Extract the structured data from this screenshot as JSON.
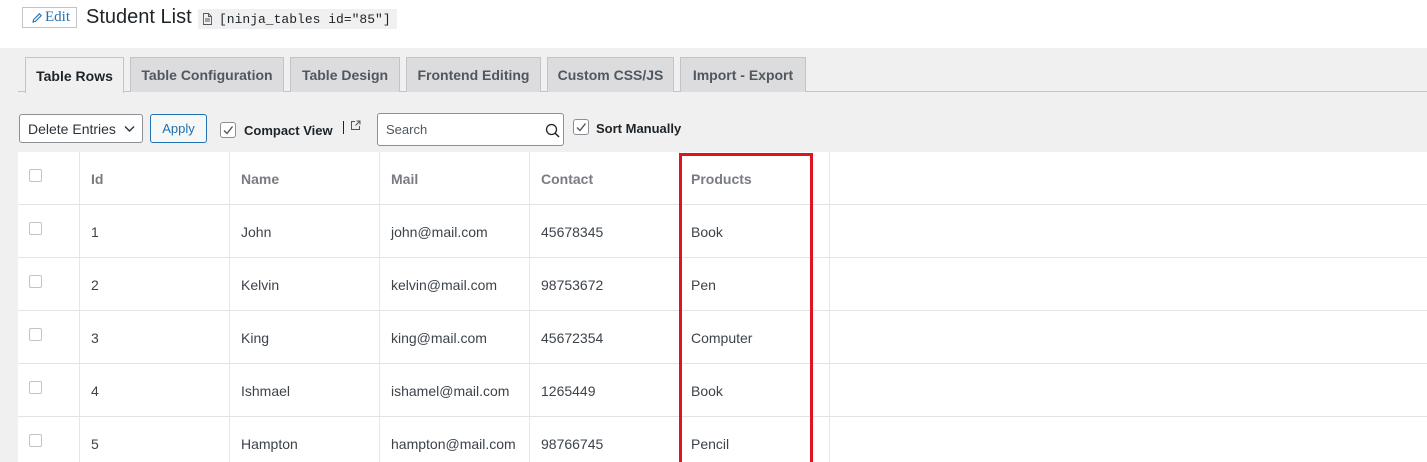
{
  "header": {
    "edit_label": "Edit",
    "title": "Student List",
    "shortcode": "[ninja_tables id=\"85\"]"
  },
  "tabs": [
    {
      "label": "Table Rows",
      "active": true
    },
    {
      "label": "Table Configuration",
      "active": false
    },
    {
      "label": "Table Design",
      "active": false
    },
    {
      "label": "Frontend Editing",
      "active": false
    },
    {
      "label": "Custom CSS/JS",
      "active": false
    },
    {
      "label": "Import - Export",
      "active": false
    }
  ],
  "toolbar": {
    "bulk_action_selected": "Delete Entries",
    "apply_label": "Apply",
    "compact_view_label": "Compact View",
    "compact_view_checked": true,
    "search_placeholder": "Search",
    "sort_manually_label": "Sort Manually",
    "sort_manually_checked": true
  },
  "table": {
    "columns": [
      "Id",
      "Name",
      "Mail",
      "Contact",
      "Products"
    ],
    "rows": [
      {
        "id": "1",
        "name": "John",
        "mail": "john@mail.com",
        "contact": "45678345",
        "products": "Book"
      },
      {
        "id": "2",
        "name": "Kelvin",
        "mail": "kelvin@mail.com",
        "contact": "98753672",
        "products": "Pen"
      },
      {
        "id": "3",
        "name": "King",
        "mail": "king@mail.com",
        "contact": "45672354",
        "products": "Computer"
      },
      {
        "id": "4",
        "name": "Ishmael",
        "mail": "ishamel@mail.com",
        "contact": "1265449",
        "products": "Book"
      },
      {
        "id": "5",
        "name": "Hampton",
        "mail": "hampton@mail.com",
        "contact": "98766745",
        "products": "Pencil"
      }
    ]
  },
  "icons": {
    "edit": "pencil-icon",
    "shortcode": "document-icon",
    "external": "external-link-icon",
    "search": "search-icon",
    "dropdown": "chevron-down-icon",
    "check": "check-icon"
  },
  "colors": {
    "link": "#2271b1",
    "highlight": "#e0141e",
    "background": "#f0f0f1"
  }
}
